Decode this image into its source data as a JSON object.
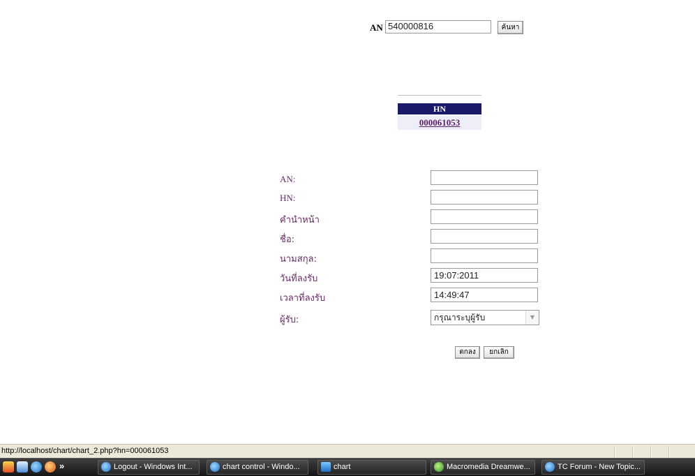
{
  "search": {
    "label": "AN",
    "value": "540000816",
    "button_label": "ค้นหา"
  },
  "hn_table": {
    "header": "HN",
    "link": "000061053"
  },
  "form": {
    "fields": [
      {
        "label": "AN:",
        "value": ""
      },
      {
        "label": "HN:",
        "value": ""
      },
      {
        "label": "คำนำหน้า",
        "value": ""
      },
      {
        "label": "ชื่อ:",
        "value": ""
      },
      {
        "label": "นามสกุล:",
        "value": ""
      },
      {
        "label": "วันที่ลงรับ",
        "value": "19:07:2011"
      },
      {
        "label": "เวลาที่ลงรับ",
        "value": "14:49:47"
      }
    ],
    "receiver": {
      "label": "ผู้รับ:",
      "selected": "กรุณาระบุผู้รับ"
    },
    "ok_label": "ตกลง",
    "cancel_label": "ยกเลิก"
  },
  "status_bar": {
    "url": "http://localhost/chart/chart_2.php?hn=000061053"
  },
  "taskbar": {
    "chevron": "»",
    "tasks": [
      {
        "label": "Logout - Windows Int...",
        "icon": "ie-icon"
      },
      {
        "label": "chart control - Windo...",
        "icon": "ie-icon"
      },
      {
        "label": "chart",
        "icon": "folder-icon"
      },
      {
        "label": "Macromedia Dreamwe...",
        "icon": "dreamweaver-icon"
      },
      {
        "label": "TC Forum - New Topic...",
        "icon": "ie-icon"
      }
    ]
  }
}
